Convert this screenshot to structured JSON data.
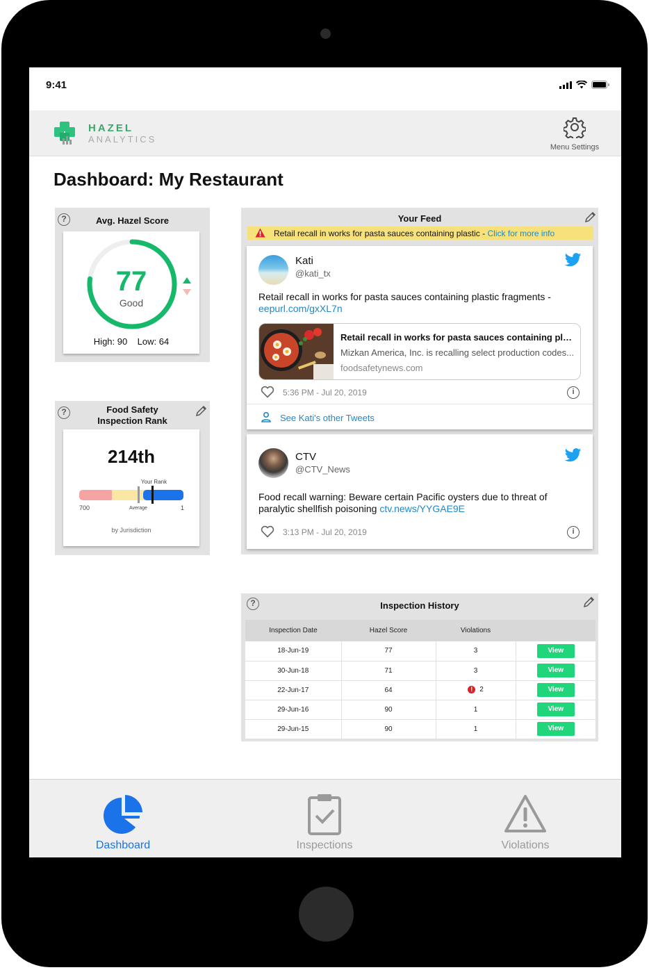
{
  "status": {
    "time": "9:41"
  },
  "brand": {
    "top": "HAZEL",
    "bottom": "ANALYTICS"
  },
  "settings": {
    "label": "Menu Settings",
    "icon": "gear-icon"
  },
  "page_title": "Dashboard: My Restaurant",
  "score_card": {
    "title": "Avg. Hazel Score",
    "value": "77",
    "rating": "Good",
    "progress": 0.77,
    "high_low": "High: 90    Low: 64",
    "accent": "#16b86a"
  },
  "rank_card": {
    "title_line1": "Food Safety",
    "title_line2": "Inspection Rank",
    "rank": "214th",
    "your_rank_label": "Your Rank",
    "min_label": "700",
    "max_label": "1",
    "avg_label": "Average",
    "footer": "by Jurisdiction"
  },
  "feed": {
    "title": "Your Feed",
    "alert_text": "Retail recall in works for pasta sauces containing plastic - ",
    "alert_link": "Click for more info",
    "tweets": [
      {
        "name": "Kati",
        "handle": "@kati_tx",
        "text": "Retail recall in works for pasta sauces containing plastic fragments - ",
        "link": "eepurl.com/gxXL7n",
        "card_title": "Retail recall in works for pasta sauces containing plas...",
        "card_desc": "Mizkan America, Inc. is recalling select production codes...",
        "card_domain": "foodsafetynews.com",
        "time": "5:36 PM - Jul 20, 2019",
        "see_more": "See Kati's other Tweets"
      },
      {
        "name": "CTV",
        "handle": "@CTV_News",
        "text": "Food recall warning: Beware certain Pacific oysters due to threat of paralytic shellfish poisoning ",
        "link": "ctv.news/YYGAE9E",
        "time": "3:13 PM - Jul 20, 2019"
      }
    ]
  },
  "history": {
    "title": "Inspection History",
    "columns": [
      "Inspection Date",
      "Hazel Score",
      "Violations",
      ""
    ],
    "view_label": "View",
    "rows": [
      {
        "date": "18-Jun-19",
        "score": "77",
        "violations": "3",
        "flag": false
      },
      {
        "date": "30-Jun-18",
        "score": "71",
        "violations": "3",
        "flag": false
      },
      {
        "date": "22-Jun-17",
        "score": "64",
        "violations": "2",
        "flag": true
      },
      {
        "date": "29-Jun-16",
        "score": "90",
        "violations": "1",
        "flag": false
      },
      {
        "date": "29-Jun-15",
        "score": "90",
        "violations": "1",
        "flag": false
      }
    ]
  },
  "nav": {
    "items": [
      {
        "label": "Dashboard",
        "icon": "pie-chart-icon",
        "active": true
      },
      {
        "label": "Inspections",
        "icon": "clipboard-check-icon",
        "active": false
      },
      {
        "label": "Violations",
        "icon": "warning-triangle-icon",
        "active": false
      }
    ],
    "active_color": "#1a73e8",
    "inactive_color": "#9a9a9a"
  }
}
